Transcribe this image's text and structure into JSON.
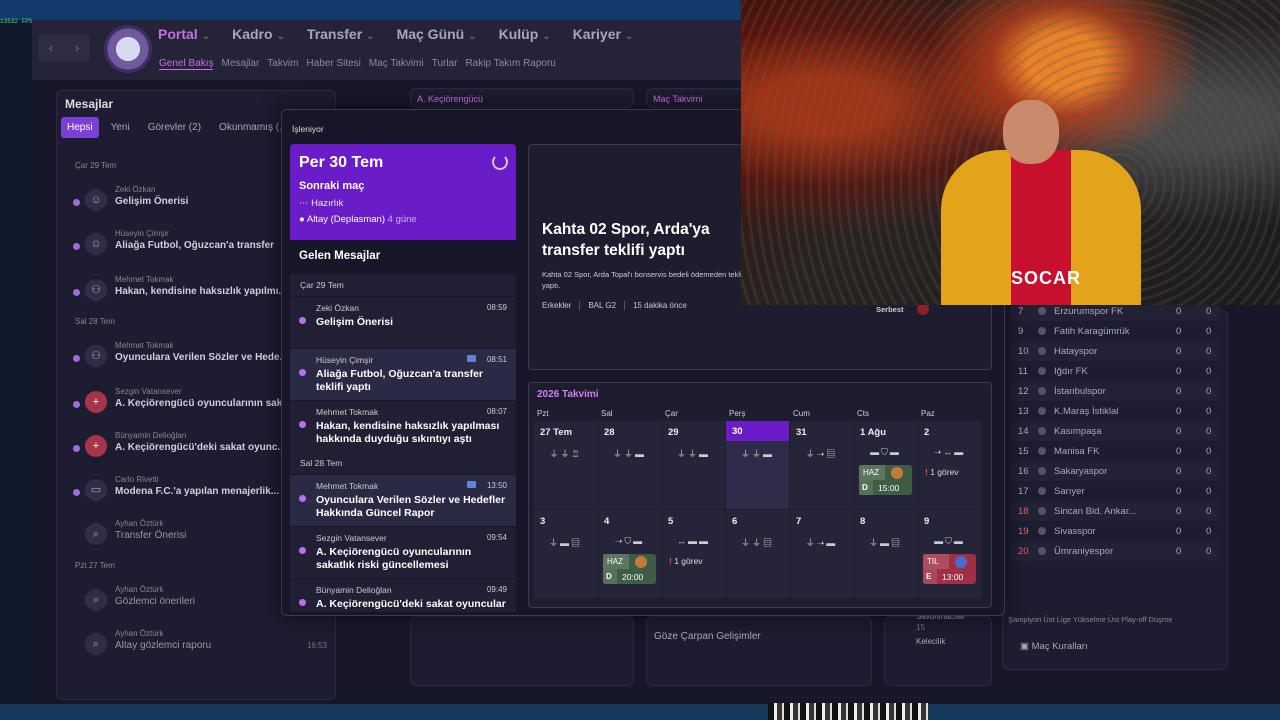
{
  "fps": "13532 FPS",
  "nav": {
    "main": [
      "Portal",
      "Kadro",
      "Transfer",
      "Maç Günü",
      "Kulüp",
      "Kariyer"
    ],
    "sub": [
      "Genel Bakış",
      "Mesajlar",
      "Takvim",
      "Haber Sitesi",
      "Maç Takvimi",
      "Turlar",
      "Rakip Takım Raporu"
    ]
  },
  "messages_panel": {
    "title": "Mesajlar",
    "filters": [
      "Hepsi",
      "Yeni",
      "Görevler (2)",
      "Okunmamış (..."
    ],
    "day1": "Çar 29 Tem",
    "day2": "Sal 28 Tem",
    "day3": "Pzt 27 Tem",
    "items": [
      {
        "from": "Zeki Özkan",
        "subject": "Gelişim Önerisi"
      },
      {
        "from": "Hüseyin Çimşir",
        "subject": "Aliağa Futbol, Oğuzcan'a transfer"
      },
      {
        "from": "Mehmet Tokmak",
        "subject": "Hakan, kendisine haksızlık yapılmı..."
      },
      {
        "from": "Mehmet Tokmak",
        "subject": "Oyunculara Verilen Sözler ve Hede..."
      },
      {
        "from": "Sezgin Vatansever",
        "subject": "A. Keçiörengücü oyuncularının sak..."
      },
      {
        "from": "Bünyamin Delioğlan",
        "subject": "A. Keçiörengücü'deki sakat oyunc..."
      },
      {
        "from": "Carlo Rivetti",
        "subject": "Modena F.C.'a yapılan menajerlik..."
      },
      {
        "from": "Ayhan Öztürk",
        "subject": "Transfer Önerisi"
      },
      {
        "from": "Ayhan Öztürk",
        "subject": "Gözlemci önerileri"
      },
      {
        "from": "Ayhan Öztürk",
        "subject": "Altay gözlemci raporu",
        "time": "16:53"
      }
    ]
  },
  "bg_headers": {
    "team": "A. Keçiörengücü",
    "fixtures": "Maç Takvimi"
  },
  "modal": {
    "title": "İşleniyor",
    "next_match": {
      "date": "Per 30 Tem",
      "label": "Sonraki maç",
      "prep": "Hazırlık",
      "opponent": "Altay (Deplasman)",
      "in_days": "4 güne"
    },
    "inbox_title": "Gelen Mesajlar",
    "inbox_day1": "Çar 29 Tem",
    "inbox_day2": "Sal 28 Tem",
    "inbox": [
      {
        "from": "Zeki Özkan",
        "time": "08:59",
        "subject": "Gelişim Önerisi"
      },
      {
        "from": "Hüseyin Çimşir",
        "time": "08:51",
        "subject": "Aliağa Futbol, Oğuzcan'a transfer teklifi yaptı"
      },
      {
        "from": "Mehmet Tokmak",
        "time": "08:07",
        "subject": "Hakan, kendisine haksızlık yapılması hakkında duyduğu sıkıntıyı aştı"
      },
      {
        "from": "Mehmet Tokmak",
        "time": "13:50",
        "subject": "Oyunculara Verilen Sözler ve Hedefler Hakkında Güncel Rapor"
      },
      {
        "from": "Sezgin Vatansever",
        "time": "09:54",
        "subject": "A. Keçiörengücü oyuncularının sakatlık riski güncellemesi"
      },
      {
        "from": "Bünyamin Delioğlan",
        "time": "09:49",
        "subject": "A. Keçiörengücü'deki sakat oyuncular"
      }
    ],
    "news": {
      "headline": "Kahta 02 Spor, Arda'ya transfer teklifi yaptı",
      "body": "Kahta 02 Spor, Arda Topal'ı bonservis bedeli ödemeden teklif yaptı.",
      "meta": [
        "Erkekler",
        "BAL G2",
        "15 dakika önce"
      ],
      "status": "Serbest"
    },
    "calendar": {
      "title": "2026 Takvimi",
      "days": [
        "Pzt",
        "Sal",
        "Çar",
        "Perş",
        "Cum",
        "Cts",
        "Paz"
      ],
      "week1": [
        "27 Tem",
        "28",
        "29",
        "30",
        "31",
        "1 Ağu",
        "2"
      ],
      "week2": [
        "3",
        "4",
        "5",
        "6",
        "7",
        "8",
        "9"
      ],
      "task_label": "1 görev",
      "match1": {
        "venue": "HAZ",
        "comp": "D",
        "time": "15:00"
      },
      "match2": {
        "venue": "HAZ",
        "comp": "D",
        "time": "20:00"
      },
      "match3": {
        "venue": "TIL",
        "comp": "E",
        "time": "13:00"
      }
    }
  },
  "league": [
    {
      "pos": "7",
      "name": "Erzurumspor FK",
      "a": "0",
      "b": "0"
    },
    {
      "pos": "9",
      "name": "Fatih Karagümrük",
      "a": "0",
      "b": "0"
    },
    {
      "pos": "10",
      "name": "Hatayspor",
      "a": "0",
      "b": "0"
    },
    {
      "pos": "11",
      "name": "Iğdır FK",
      "a": "0",
      "b": "0"
    },
    {
      "pos": "12",
      "name": "İstanbulspor",
      "a": "0",
      "b": "0"
    },
    {
      "pos": "13",
      "name": "K.Maraş İstiklal",
      "a": "0",
      "b": "0"
    },
    {
      "pos": "14",
      "name": "Kasımpaşa",
      "a": "0",
      "b": "0"
    },
    {
      "pos": "15",
      "name": "Manisa FK",
      "a": "0",
      "b": "0"
    },
    {
      "pos": "16",
      "name": "Sakaryaspor",
      "a": "0",
      "b": "0"
    },
    {
      "pos": "17",
      "name": "Sarıyer",
      "a": "0",
      "b": "0"
    },
    {
      "pos": "18",
      "name": "Sincan Bld. Ankar...",
      "a": "0",
      "b": "0"
    },
    {
      "pos": "19",
      "name": "Sivasspor",
      "a": "0",
      "b": "0"
    },
    {
      "pos": "20",
      "name": "Ümraniyespor",
      "a": "0",
      "b": "0"
    }
  ],
  "league_legend": "Şampiyon   Üst Lige Yükselme   Üst Play-off Düşme",
  "league_rules": "Maç Kuralları",
  "bottom": {
    "highlights": "Göze Çarpan Gelişimler",
    "defenders": "Savunmacılar",
    "def_count": "15",
    "goalkeepers": "Kelecilik"
  },
  "video": {
    "sponsor": "SOCAR"
  }
}
